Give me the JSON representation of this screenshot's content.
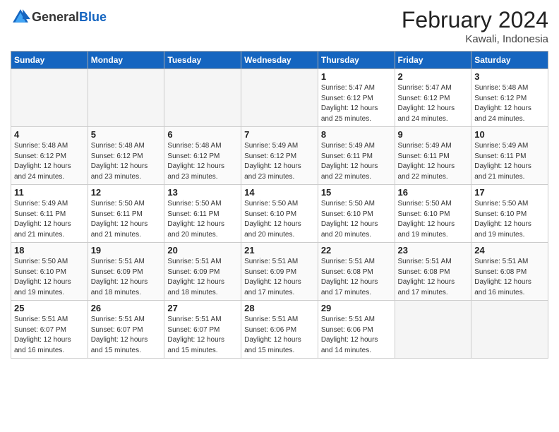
{
  "header": {
    "logo_general": "General",
    "logo_blue": "Blue",
    "title": "February 2024",
    "location": "Kawali, Indonesia"
  },
  "days_of_week": [
    "Sunday",
    "Monday",
    "Tuesday",
    "Wednesday",
    "Thursday",
    "Friday",
    "Saturday"
  ],
  "weeks": [
    [
      {
        "day": "",
        "info": ""
      },
      {
        "day": "",
        "info": ""
      },
      {
        "day": "",
        "info": ""
      },
      {
        "day": "",
        "info": ""
      },
      {
        "day": "1",
        "info": "Sunrise: 5:47 AM\nSunset: 6:12 PM\nDaylight: 12 hours\nand 25 minutes."
      },
      {
        "day": "2",
        "info": "Sunrise: 5:47 AM\nSunset: 6:12 PM\nDaylight: 12 hours\nand 24 minutes."
      },
      {
        "day": "3",
        "info": "Sunrise: 5:48 AM\nSunset: 6:12 PM\nDaylight: 12 hours\nand 24 minutes."
      }
    ],
    [
      {
        "day": "4",
        "info": "Sunrise: 5:48 AM\nSunset: 6:12 PM\nDaylight: 12 hours\nand 24 minutes."
      },
      {
        "day": "5",
        "info": "Sunrise: 5:48 AM\nSunset: 6:12 PM\nDaylight: 12 hours\nand 23 minutes."
      },
      {
        "day": "6",
        "info": "Sunrise: 5:48 AM\nSunset: 6:12 PM\nDaylight: 12 hours\nand 23 minutes."
      },
      {
        "day": "7",
        "info": "Sunrise: 5:49 AM\nSunset: 6:12 PM\nDaylight: 12 hours\nand 23 minutes."
      },
      {
        "day": "8",
        "info": "Sunrise: 5:49 AM\nSunset: 6:11 PM\nDaylight: 12 hours\nand 22 minutes."
      },
      {
        "day": "9",
        "info": "Sunrise: 5:49 AM\nSunset: 6:11 PM\nDaylight: 12 hours\nand 22 minutes."
      },
      {
        "day": "10",
        "info": "Sunrise: 5:49 AM\nSunset: 6:11 PM\nDaylight: 12 hours\nand 21 minutes."
      }
    ],
    [
      {
        "day": "11",
        "info": "Sunrise: 5:49 AM\nSunset: 6:11 PM\nDaylight: 12 hours\nand 21 minutes."
      },
      {
        "day": "12",
        "info": "Sunrise: 5:50 AM\nSunset: 6:11 PM\nDaylight: 12 hours\nand 21 minutes."
      },
      {
        "day": "13",
        "info": "Sunrise: 5:50 AM\nSunset: 6:11 PM\nDaylight: 12 hours\nand 20 minutes."
      },
      {
        "day": "14",
        "info": "Sunrise: 5:50 AM\nSunset: 6:10 PM\nDaylight: 12 hours\nand 20 minutes."
      },
      {
        "day": "15",
        "info": "Sunrise: 5:50 AM\nSunset: 6:10 PM\nDaylight: 12 hours\nand 20 minutes."
      },
      {
        "day": "16",
        "info": "Sunrise: 5:50 AM\nSunset: 6:10 PM\nDaylight: 12 hours\nand 19 minutes."
      },
      {
        "day": "17",
        "info": "Sunrise: 5:50 AM\nSunset: 6:10 PM\nDaylight: 12 hours\nand 19 minutes."
      }
    ],
    [
      {
        "day": "18",
        "info": "Sunrise: 5:50 AM\nSunset: 6:10 PM\nDaylight: 12 hours\nand 19 minutes."
      },
      {
        "day": "19",
        "info": "Sunrise: 5:51 AM\nSunset: 6:09 PM\nDaylight: 12 hours\nand 18 minutes."
      },
      {
        "day": "20",
        "info": "Sunrise: 5:51 AM\nSunset: 6:09 PM\nDaylight: 12 hours\nand 18 minutes."
      },
      {
        "day": "21",
        "info": "Sunrise: 5:51 AM\nSunset: 6:09 PM\nDaylight: 12 hours\nand 17 minutes."
      },
      {
        "day": "22",
        "info": "Sunrise: 5:51 AM\nSunset: 6:08 PM\nDaylight: 12 hours\nand 17 minutes."
      },
      {
        "day": "23",
        "info": "Sunrise: 5:51 AM\nSunset: 6:08 PM\nDaylight: 12 hours\nand 17 minutes."
      },
      {
        "day": "24",
        "info": "Sunrise: 5:51 AM\nSunset: 6:08 PM\nDaylight: 12 hours\nand 16 minutes."
      }
    ],
    [
      {
        "day": "25",
        "info": "Sunrise: 5:51 AM\nSunset: 6:07 PM\nDaylight: 12 hours\nand 16 minutes."
      },
      {
        "day": "26",
        "info": "Sunrise: 5:51 AM\nSunset: 6:07 PM\nDaylight: 12 hours\nand 15 minutes."
      },
      {
        "day": "27",
        "info": "Sunrise: 5:51 AM\nSunset: 6:07 PM\nDaylight: 12 hours\nand 15 minutes."
      },
      {
        "day": "28",
        "info": "Sunrise: 5:51 AM\nSunset: 6:06 PM\nDaylight: 12 hours\nand 15 minutes."
      },
      {
        "day": "29",
        "info": "Sunrise: 5:51 AM\nSunset: 6:06 PM\nDaylight: 12 hours\nand 14 minutes."
      },
      {
        "day": "",
        "info": ""
      },
      {
        "day": "",
        "info": ""
      }
    ]
  ]
}
